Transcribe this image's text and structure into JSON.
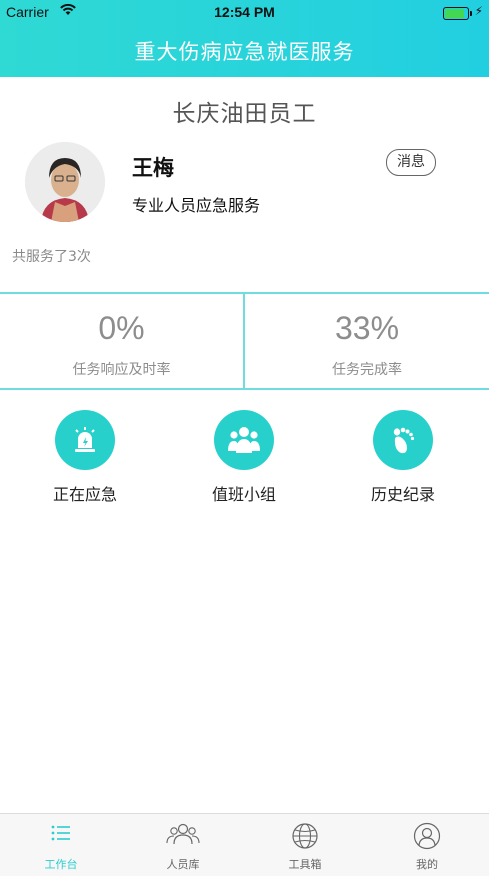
{
  "status_bar": {
    "carrier": "Carrier",
    "time": "12:54 PM",
    "battery_level": 0.9
  },
  "header": {
    "title": "重大伤病应急就医服务"
  },
  "profile": {
    "organization": "长庆油田员工",
    "name": "王梅",
    "role": "专业人员应急服务",
    "message_button": "消息",
    "served_count_text": "共服务了3次"
  },
  "stats": [
    {
      "value": "0%",
      "label": "任务响应及时率"
    },
    {
      "value": "33%",
      "label": "任务完成率"
    }
  ],
  "actions": [
    {
      "label": "正在应急",
      "icon": "alarm-light-icon"
    },
    {
      "label": "值班小组",
      "icon": "group-people-icon"
    },
    {
      "label": "历史纪录",
      "icon": "footprint-icon"
    }
  ],
  "tabs": [
    {
      "label": "工作台",
      "icon": "list-icon",
      "active": true
    },
    {
      "label": "人员库",
      "icon": "people-icon",
      "active": false
    },
    {
      "label": "工具箱",
      "icon": "globe-icon",
      "active": false
    },
    {
      "label": "我的",
      "icon": "user-icon",
      "active": false
    }
  ],
  "colors": {
    "accent": "#28d0cb",
    "header_gradient_start": "#2fd9d4",
    "header_gradient_end": "#22cfe0",
    "divider": "#6fdcdf"
  }
}
